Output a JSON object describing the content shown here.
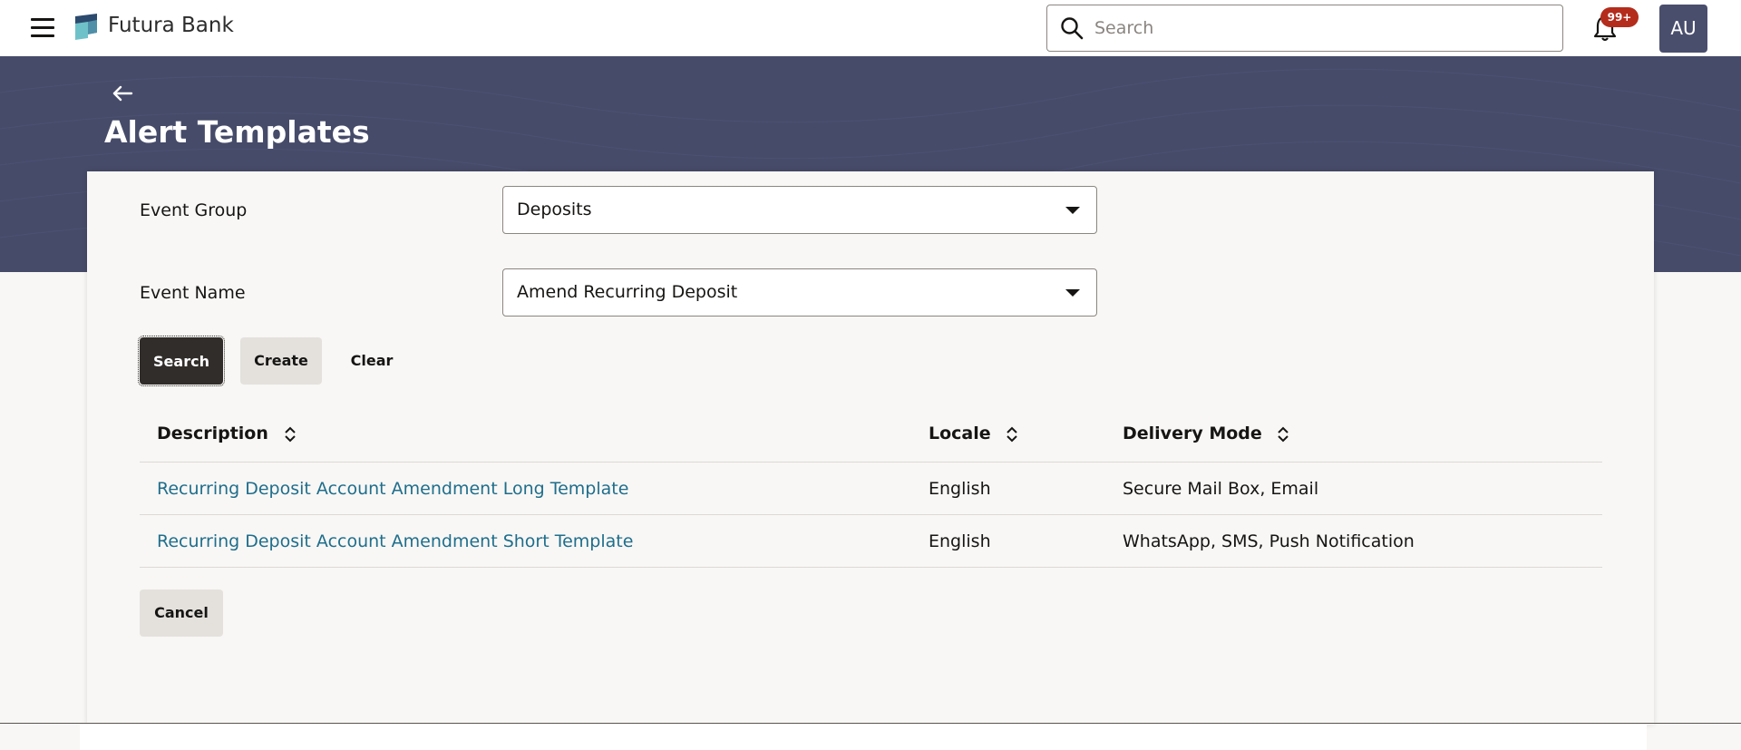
{
  "header": {
    "brand": "Futura Bank",
    "search_placeholder": "Search",
    "notification_count": "99+",
    "avatar_initials": "AU",
    "colors": {
      "header_bg": "#ffffff",
      "badge": "#b42c1c",
      "avatar": "#4a4e6d"
    }
  },
  "banner": {
    "title": "Alert Templates",
    "color": "#464b69"
  },
  "form": {
    "event_group_label": "Event Group",
    "event_group_value": "Deposits",
    "event_name_label": "Event Name",
    "event_name_value": "Amend Recurring Deposit"
  },
  "actions": {
    "search_label": "Search",
    "create_label": "Create",
    "clear_label": "Clear",
    "cancel_label": "Cancel"
  },
  "table": {
    "headers": [
      "Description",
      "Locale",
      "Delivery Mode"
    ],
    "rows": [
      {
        "description": "Recurring Deposit Account Amendment Long Template",
        "locale": "English",
        "delivery": "Secure Mail Box, Email"
      },
      {
        "description": "Recurring Deposit Account Amendment Short Template",
        "locale": "English",
        "delivery": "WhatsApp, SMS, Push Notification"
      }
    ]
  },
  "icons": [
    "hamburger-icon",
    "bank-logo-icon",
    "search-icon",
    "bell-icon",
    "back-arrow-icon",
    "sort-icon",
    "chevron-down-icon"
  ]
}
